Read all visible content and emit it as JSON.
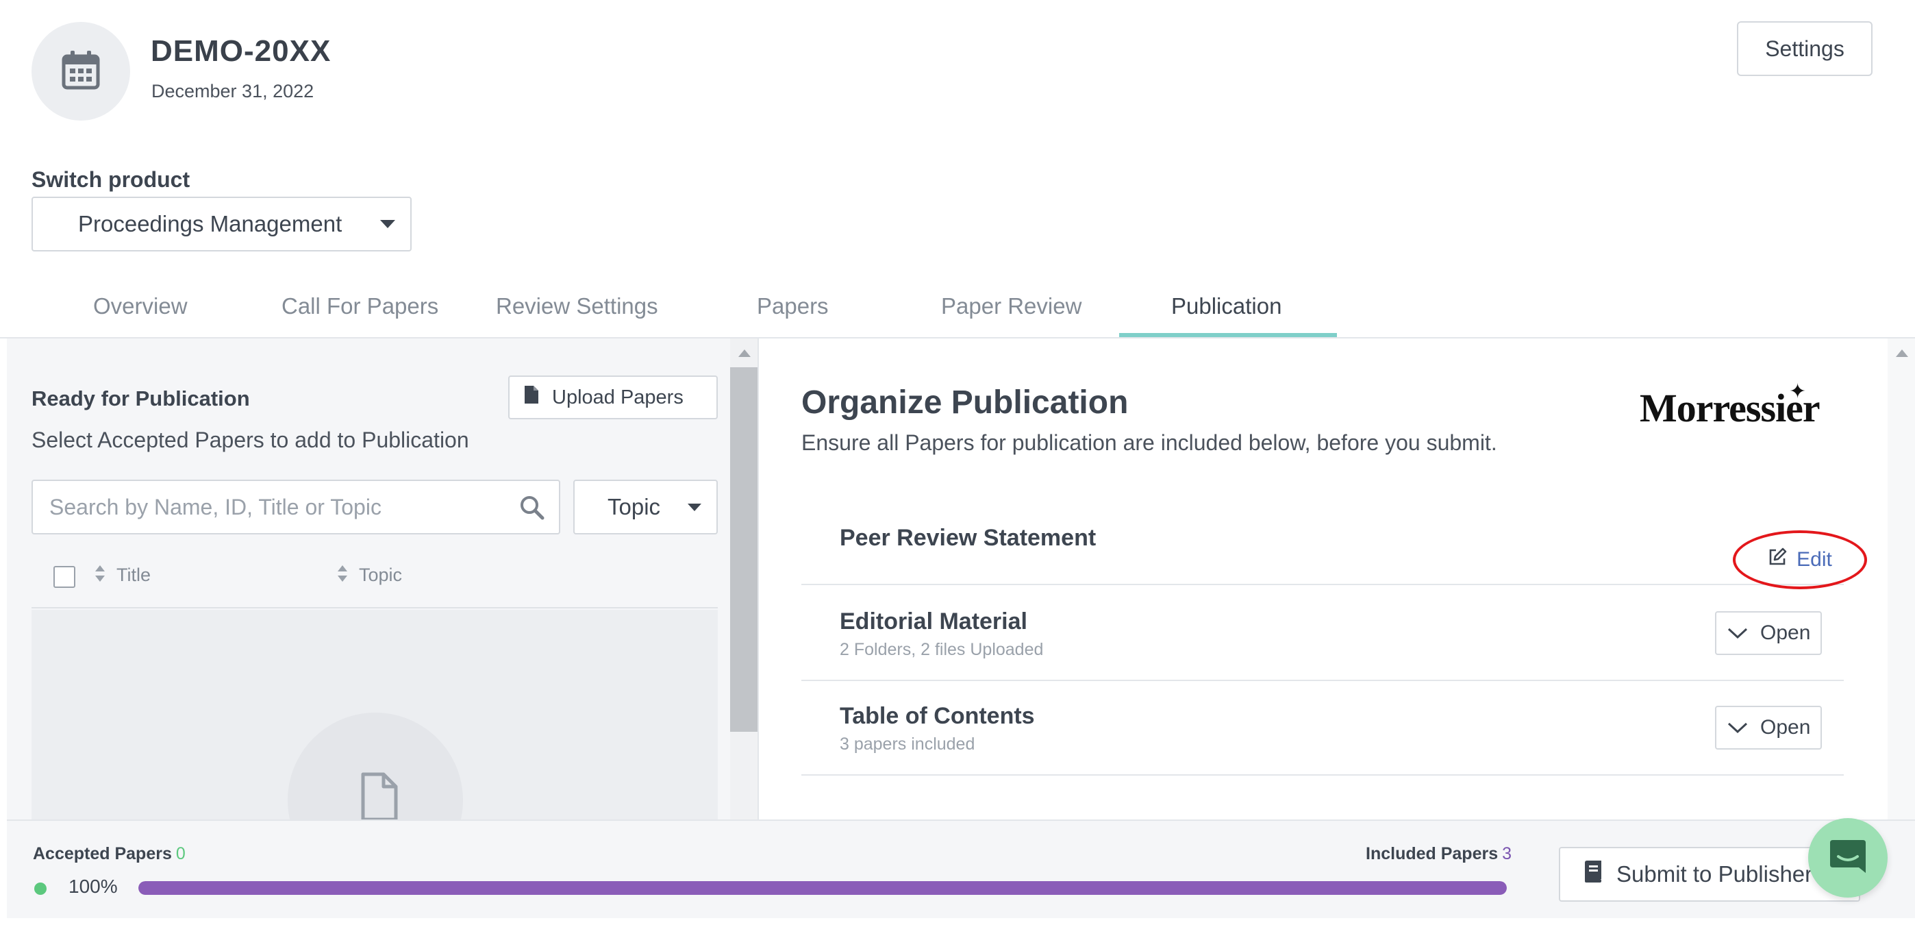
{
  "header": {
    "event_name": "DEMO-20XX",
    "event_date": "December 31, 2022",
    "settings_label": "Settings"
  },
  "product_switch": {
    "label": "Switch product",
    "selected": "Proceedings Management"
  },
  "tabs": [
    {
      "label": "Overview"
    },
    {
      "label": "Call For Papers"
    },
    {
      "label": "Review Settings"
    },
    {
      "label": "Papers"
    },
    {
      "label": "Paper Review"
    },
    {
      "label": "Publication"
    }
  ],
  "left_panel": {
    "title": "Ready for Publication",
    "subtitle": "Select Accepted Papers to add to Publication",
    "upload_label": "Upload Papers",
    "search_placeholder": "Search by Name, ID, Title or Topic",
    "topic_filter": "Topic",
    "columns": {
      "title": "Title",
      "topic": "Topic"
    }
  },
  "main": {
    "title": "Organize Publication",
    "subtitle": "Ensure all Papers for publication are included below, before you submit.",
    "logo_text": "Morressier",
    "sections": [
      {
        "title": "Peer Review Statement",
        "meta": "",
        "action": "Edit"
      },
      {
        "title": "Editorial Material",
        "meta": "2 Folders, 2 files Uploaded",
        "action": "Open"
      },
      {
        "title": "Table of Contents",
        "meta": "3 papers included",
        "action": "Open"
      }
    ]
  },
  "footer": {
    "accepted_label": "Accepted Papers",
    "accepted_count": "0",
    "percent": "100%",
    "progress": 1.0,
    "included_label": "Included Papers",
    "included_count": "3",
    "submit_label": "Submit to Publisher"
  },
  "colors": {
    "tab_active_underline": "#7fcfc9",
    "progress_fill": "#8a5cb8",
    "accepted_green": "#5cc87e",
    "edit_highlight": "#e3171b",
    "chat_bubble": "#9de0b4"
  }
}
